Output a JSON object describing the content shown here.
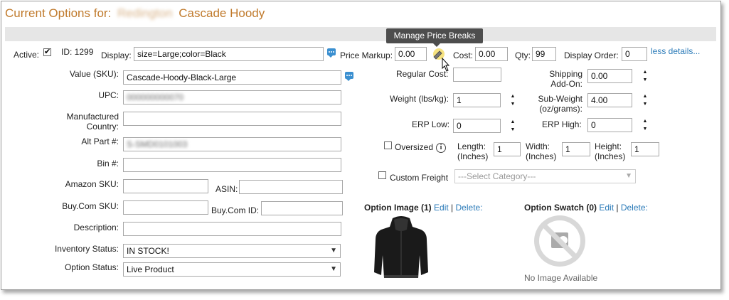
{
  "header": {
    "title_prefix": "Current Options for:",
    "title_blurred": "Redington",
    "title_product": "Cascade Hoody"
  },
  "tooltip": {
    "text": "Manage Price Breaks"
  },
  "row1": {
    "active_label": "Active:",
    "active_checked": true,
    "id_label": "ID: 1299",
    "display_label": "Display:",
    "display_value": "size=Large;color=Black",
    "price_markup_label": "Price Markup:",
    "price_markup_value": "0.00",
    "cost_label": "Cost:",
    "cost_value": "0.00",
    "qty_label": "Qty:",
    "qty_value": "99",
    "display_order_label": "Display Order:",
    "display_order_value": "0",
    "less_details_link": "less details..."
  },
  "left": {
    "value_sku_label": "Value (SKU):",
    "value_sku_value": "Cascade-Hoody-Black-Large",
    "upc_label": "UPC:",
    "upc_value": "000000000070",
    "manufactured_country_label_1": "Manufactured",
    "manufactured_country_label_2": "Country:",
    "manufactured_country_value": "",
    "alt_part_label": "Alt Part #:",
    "alt_part_value": "S-SMD0101003",
    "bin_label": "Bin #:",
    "bin_value": "",
    "amazon_sku_label": "Amazon SKU:",
    "amazon_sku_value": "",
    "asin_label": "ASIN:",
    "asin_value": "",
    "buycom_sku_label": "Buy.Com SKU:",
    "buycom_sku_value": "",
    "buycom_id_label": "Buy.Com ID:",
    "buycom_id_value": "",
    "description_label": "Description:",
    "description_value": "",
    "inventory_status_label": "Inventory Status:",
    "inventory_status_value": "IN STOCK!",
    "option_status_label": "Option Status:",
    "option_status_value": "Live Product"
  },
  "right": {
    "regular_cost_label": "Regular Cost:",
    "regular_cost_value": "",
    "shipping_addon_label_1": "Shipping",
    "shipping_addon_label_2": "Add-On:",
    "shipping_addon_value": "0.00",
    "weight_label": "Weight (lbs/kg):",
    "weight_value": "1",
    "subweight_label_1": "Sub-Weight",
    "subweight_label_2": "(oz/grams):",
    "subweight_value": "4.00",
    "erp_low_label": "ERP Low:",
    "erp_low_value": "0",
    "erp_high_label": "ERP High:",
    "erp_high_value": "0",
    "oversized_label": "Oversized",
    "oversized_checked": false,
    "length_label_1": "Length:",
    "length_label_2": "(Inches)",
    "length_value": "1",
    "width_label_1": "Width:",
    "width_label_2": "(Inches)",
    "width_value": "1",
    "height_label_1": "Height:",
    "height_label_2": "(Inches)",
    "height_value": "1",
    "custom_freight_label": "Custom Freight",
    "custom_freight_checked": false,
    "category_placeholder": "---Select Category---"
  },
  "images": {
    "option_image_label": "Option Image (1)",
    "option_image_edit": "Edit",
    "option_image_delete": "Delete:",
    "option_swatch_label": "Option Swatch (0)",
    "option_swatch_edit": "Edit",
    "option_swatch_delete": "Delete:",
    "separator": "|",
    "no_image_text": "No Image Available"
  },
  "colors": {
    "title": "#c07a2c",
    "link": "#2a7ab8",
    "tooltip_bg": "#4d4d4d",
    "header_bar": "#e6e6e6"
  }
}
